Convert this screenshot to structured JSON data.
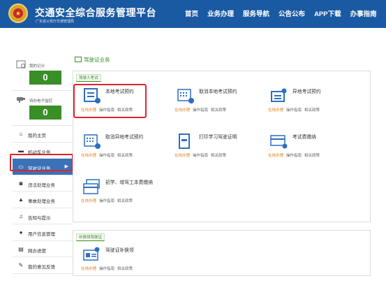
{
  "header": {
    "title": "交通安全综合服务管理平台",
    "subtitle": "广东省公安厅交通管理局",
    "nav": [
      "首页",
      "业务办理",
      "服务导航",
      "公告公布",
      "APP下载",
      "办事指南"
    ]
  },
  "sidebar": {
    "stats": [
      {
        "label": "我的记分",
        "value": "0",
        "icon": "document-icon"
      },
      {
        "label": "待办电子监控",
        "value": "0",
        "icon": "camera-icon"
      }
    ],
    "items": [
      {
        "label": "我的主页",
        "icon": "home-icon"
      },
      {
        "label": "机动车业务",
        "icon": "car-icon"
      },
      {
        "label": "驾驶证业务",
        "icon": "card-icon",
        "active": true
      },
      {
        "label": "违法处理业务",
        "icon": "camera-icon"
      },
      {
        "label": "事故处理业务",
        "icon": "warning-icon"
      },
      {
        "label": "告知与提示",
        "icon": "bell-icon"
      },
      {
        "label": "用户信息管理",
        "icon": "user-icon"
      },
      {
        "label": "网办进度",
        "icon": "progress-icon"
      },
      {
        "label": "我的意见反馈",
        "icon": "feedback-icon"
      }
    ],
    "active_arrow": "▶"
  },
  "main": {
    "title": "驾驶证业务",
    "sections": [
      {
        "tag": "驾驶人考试",
        "services": [
          {
            "title": "本地考试预约",
            "icon": "calendar-form-icon"
          },
          {
            "title": "取消本地考试预约",
            "icon": "calendar-cancel-icon"
          },
          {
            "title": "异地考试预约",
            "icon": "form-person-icon"
          },
          {
            "title": "取消异地考试预约",
            "icon": "calendar-cancel-icon"
          },
          {
            "title": "打印学习驾驶证明",
            "icon": "print-icon"
          },
          {
            "title": "考试费缴纳",
            "icon": "payment-icon"
          },
          {
            "title": "初学、增驾工本费缴纳",
            "icon": "payment-icon"
          }
        ]
      },
      {
        "tag": "补换领驾驶证",
        "services": [
          {
            "title": "驾驶证补换领",
            "icon": "license-icon"
          }
        ]
      }
    ],
    "link_labels": {
      "online": "在线办理",
      "guide": "操作指南",
      "policy": "相关政策"
    }
  },
  "colors": {
    "header": "#1a5aa3",
    "accent_green": "#3a8e28",
    "active_blue": "#3a71b7",
    "highlight_red": "#e0232b",
    "online_orange": "#e0811f"
  }
}
